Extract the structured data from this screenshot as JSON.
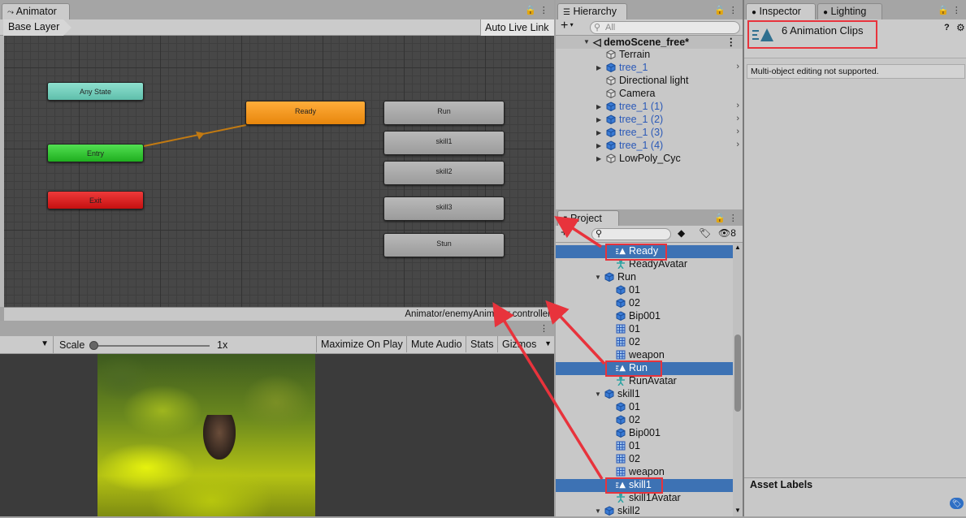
{
  "animator": {
    "tab": "Animator",
    "layer": "Base Layer",
    "live_link": "Auto Live Link",
    "footer_path": "Animator/enemyAnimator.controller",
    "nodes": {
      "any_state": "Any State",
      "entry": "Entry",
      "exit": "Exit",
      "ready": "Ready",
      "run": "Run",
      "skill1": "skill1",
      "skill2": "skill2",
      "skill3": "skill3",
      "stun": "Stun"
    },
    "colors": {
      "any_state": "#6fcbb8",
      "entry": "#26b826",
      "exit": "#d81818",
      "ready": "#f09214",
      "transition": "#c27a12"
    }
  },
  "game": {
    "scale_label": "Scale",
    "scale_value": "1x",
    "maximize": "Maximize On Play",
    "mute": "Mute Audio",
    "stats": "Stats",
    "gizmos": "Gizmos"
  },
  "hierarchy": {
    "tab": "Hierarchy",
    "search_placeholder": "All",
    "scene": "demoScene_free*",
    "items": [
      "Terrain",
      "tree_1",
      "Directional light",
      "Camera",
      "tree_1 (1)",
      "tree_1 (2)",
      "tree_1 (3)",
      "tree_1 (4)",
      "LowPoly_Cyc"
    ]
  },
  "project": {
    "tab": "Project",
    "hidden_count": "8",
    "items": [
      "Ready",
      "ReadyAvatar",
      "Run",
      "01",
      "02",
      "Bip001",
      "01",
      "02",
      "weapon",
      "Run",
      "RunAvatar",
      "skill1",
      "01",
      "02",
      "Bip001",
      "01",
      "02",
      "weapon",
      "skill1",
      "skill1Avatar",
      "skill2"
    ]
  },
  "inspector": {
    "tab": "Inspector",
    "tab2": "Lighting",
    "title": "6 Animation Clips",
    "message": "Multi-object editing not supported.",
    "asset_labels": "Asset Labels"
  },
  "annotation_color": "#e8333c"
}
